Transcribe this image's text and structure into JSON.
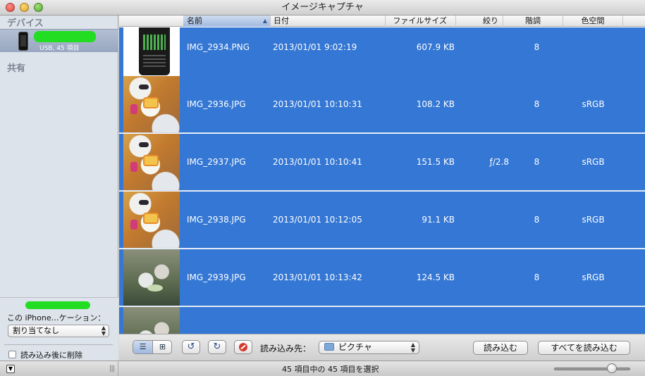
{
  "window": {
    "title": "イメージキャプチャ"
  },
  "sidebar": {
    "devices_header": "デバイス",
    "device": {
      "subtitle": "USB, 45 項目"
    },
    "shared_header": "共有",
    "app_label": "この iPhone…ケーション：",
    "app_select_value": "割り当てなし",
    "delete_after_import_label": "読み込み後に削除"
  },
  "columns": {
    "name": "名前",
    "date": "日付",
    "size": "ファイルサイズ",
    "aperture": "絞り",
    "depth": "階調",
    "color_space": "色空間"
  },
  "rows": [
    {
      "name": "IMG_2934.PNG",
      "date": "2013/01/01 9:02:19",
      "size": "607.9 KB",
      "aperture": "",
      "depth": "8",
      "color_space": "",
      "thumb": "phone-screenshot"
    },
    {
      "name": "IMG_2936.JPG",
      "date": "2013/01/01 10:10:31",
      "size": "108.2 KB",
      "aperture": "",
      "depth": "8",
      "color_space": "sRGB",
      "thumb": "food"
    },
    {
      "name": "IMG_2937.JPG",
      "date": "2013/01/01 10:10:41",
      "size": "151.5 KB",
      "aperture": "ƒ/2.8",
      "depth": "8",
      "color_space": "sRGB",
      "thumb": "food"
    },
    {
      "name": "IMG_2938.JPG",
      "date": "2013/01/01 10:12:05",
      "size": "91.1 KB",
      "aperture": "",
      "depth": "8",
      "color_space": "sRGB",
      "thumb": "food"
    },
    {
      "name": "IMG_2939.JPG",
      "date": "2013/01/01 10:13:42",
      "size": "124.5 KB",
      "aperture": "",
      "depth": "8",
      "color_space": "sRGB",
      "thumb": "table"
    }
  ],
  "toolbar": {
    "destination_label": "読み込み先：",
    "destination_value": "ピクチャ",
    "import_label": "読み込む",
    "import_all_label": "すべてを読み込む"
  },
  "status": {
    "text": "45 項目中の 45 項目を選択"
  },
  "colors": {
    "selection": "#3477d4",
    "redaction": "#22dd22"
  }
}
